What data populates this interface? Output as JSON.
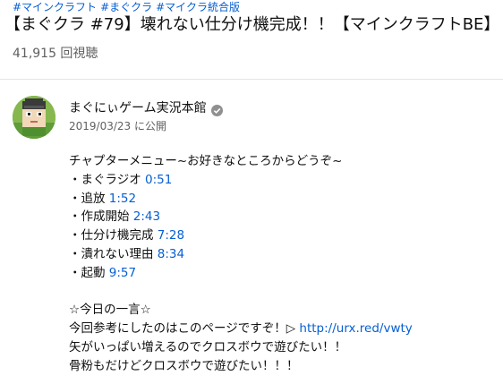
{
  "hashtags": [
    "#マインクラフト",
    "#まぐクラ",
    "#マイクラ統合版"
  ],
  "video": {
    "title": "【まぐクラ #79】壊れない仕分け機完成！！【マインクラフトBE】",
    "views": "41,915 回視聴"
  },
  "channel": {
    "name": "まぐにぃゲーム実況本館",
    "verified_icon": "verified-check-icon",
    "published": "2019/03/23 に公開"
  },
  "description": {
    "intro": "チャプターメニュー~お好きなところからどうぞ~",
    "chapters": [
      {
        "bullet": "・",
        "label": "まぐラジオ ",
        "time": "0:51"
      },
      {
        "bullet": "・",
        "label": "追放 ",
        "time": "1:52"
      },
      {
        "bullet": "・",
        "label": "作成開始 ",
        "time": "2:43"
      },
      {
        "bullet": "・",
        "label": "仕分け機完成 ",
        "time": "7:28"
      },
      {
        "bullet": "・",
        "label": "潰れない理由 ",
        "time": "8:34"
      },
      {
        "bullet": "・",
        "label": "起動 ",
        "time": "9:57"
      }
    ],
    "quote_heading": "☆今日の一言☆",
    "quote_line1_text": "今回参考にしたのはこのページですぞ！▷ ",
    "quote_line1_link": "http://urx.red/vwty",
    "quote_line2": "矢がいっぱい増えるのでクロスボウで遊びたい！！",
    "quote_line3": "骨粉もだけどクロスボウで遊びたい！！！"
  },
  "colors": {
    "link": "#065fd4",
    "secondary_text": "#606060",
    "primary_text": "#0f0f0f",
    "divider": "#e5e5e5"
  }
}
